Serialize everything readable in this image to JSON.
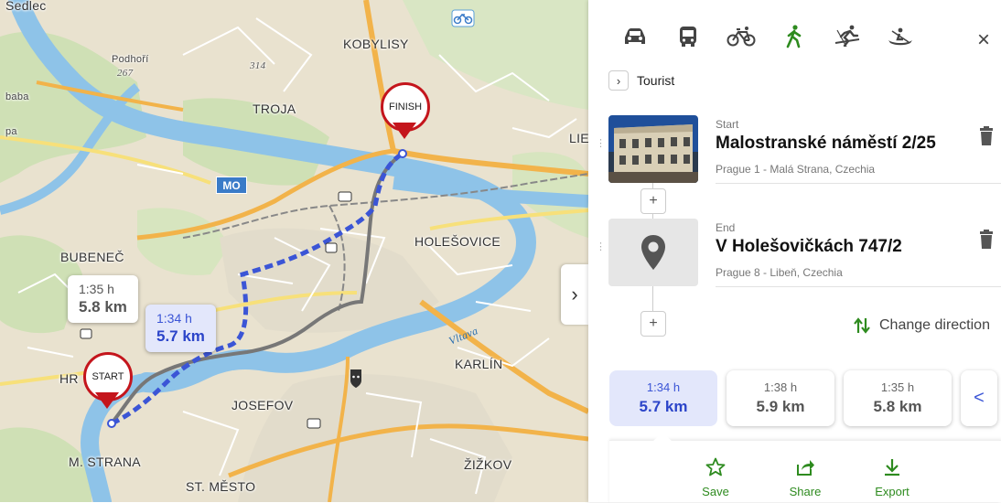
{
  "map": {
    "places": {
      "sedlec": "Sedlec",
      "kobylisy": "KOBYLISY",
      "podhori": "Podhoří",
      "hill_267": "267",
      "hill_314": "314",
      "baba": "baba",
      "pa": "pa",
      "troja": "TROJA",
      "lie": "LIE",
      "mo": "MO",
      "bubenec": "BUBENEČ",
      "holesovice": "HOLEŠOVICE",
      "vltava": "Vltava",
      "karlin": "KARLÍN",
      "hr": "HR",
      "josefov": "JOSEFOV",
      "m_strana": "M. STRANA",
      "st_mesto": "ST. MĚSTO",
      "zizkov": "ŽIŽKOV"
    },
    "bubble_alt": {
      "time": "1:35 h",
      "distance": "5.8 km"
    },
    "bubble_main": {
      "time": "1:34 h",
      "distance": "5.7 km"
    },
    "pin_start": "START",
    "pin_finish": "FINISH",
    "colors": {
      "route": "#3b55d6",
      "alt_route": "#777777",
      "pin": "#c4151c",
      "water": "#8ec3e8"
    }
  },
  "panel": {
    "modes": [
      {
        "name": "car-icon",
        "active": false
      },
      {
        "name": "bus-icon",
        "active": false
      },
      {
        "name": "bicycle-icon",
        "active": false
      },
      {
        "name": "walking-icon",
        "active": true
      },
      {
        "name": "ski-icon",
        "active": false
      },
      {
        "name": "canoe-icon",
        "active": false
      }
    ],
    "close": "×",
    "tourist_label": "Tourist",
    "start": {
      "kind": "Start",
      "name": "Malostranské náměstí 2/25",
      "address": "Prague 1 - Malá Strana, Czechia"
    },
    "end": {
      "kind": "End",
      "name": "V Holešovičkách 747/2",
      "address": "Prague 8 - Libeň, Czechia"
    },
    "plus": "+",
    "change_direction": "Change direction",
    "routes": [
      {
        "time": "1:34 h",
        "distance": "5.7 km",
        "active": true
      },
      {
        "time": "1:38 h",
        "distance": "5.9 km",
        "active": false
      },
      {
        "time": "1:35 h",
        "distance": "5.8 km",
        "active": false
      }
    ],
    "routes_arrow": "<",
    "actions": {
      "save": "Save",
      "share": "Share",
      "export": "Export"
    },
    "accent": "#2e8b1f"
  }
}
